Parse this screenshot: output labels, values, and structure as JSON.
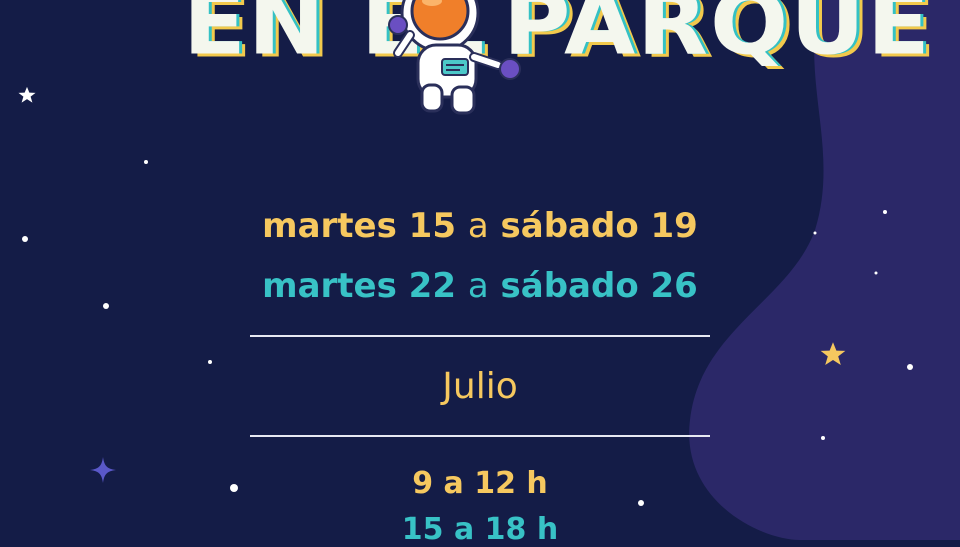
{
  "title": {
    "left": "EN EL",
    "right": "PARQUE"
  },
  "dates": [
    {
      "from_day": "martes 15",
      "sep": "a",
      "to_day": "sábado 19"
    },
    {
      "from_day": "martes 22",
      "sep": "a",
      "to_day": "sábado 26"
    }
  ],
  "month": "Julio",
  "hours": [
    {
      "start": "9",
      "sep": "a",
      "end": "12 h"
    },
    {
      "start": "15",
      "sep": "a",
      "end": "18 h"
    }
  ],
  "colors": {
    "background": "#141c47",
    "blob": "#2b2868",
    "yellow": "#f6c85f",
    "teal": "#38c2c6",
    "white": "#f4f7ee"
  },
  "icons": [
    "astronaut-illustration",
    "star-icon",
    "sparkle-icon"
  ]
}
